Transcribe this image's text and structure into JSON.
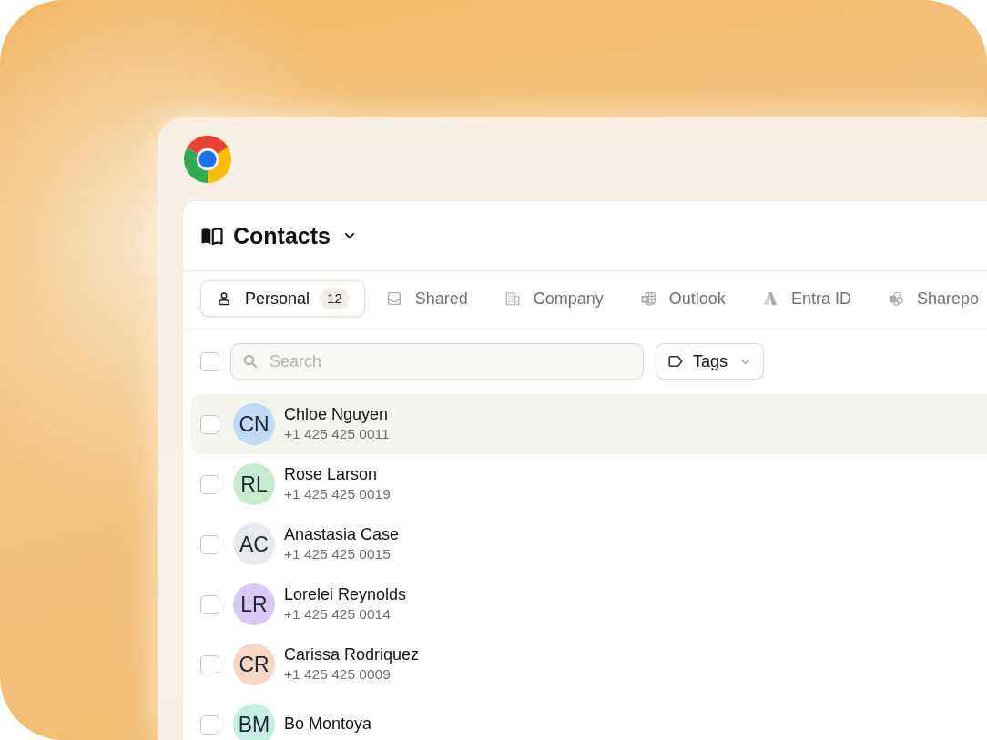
{
  "header": {
    "title": "Contacts"
  },
  "tabs": [
    {
      "kind": "personal",
      "label": "Personal",
      "count": "12",
      "selected": true
    },
    {
      "kind": "shared",
      "label": "Shared",
      "selected": false
    },
    {
      "kind": "company",
      "label": "Company",
      "selected": false
    },
    {
      "kind": "outlook",
      "label": "Outlook",
      "selected": false
    },
    {
      "kind": "entra",
      "label": "Entra ID",
      "selected": false
    },
    {
      "kind": "sharepoint",
      "label": "Sharepo",
      "selected": false
    }
  ],
  "toolbar": {
    "select_all": {
      "checked": false
    },
    "search": {
      "placeholder": "Search"
    },
    "tags_button": {
      "label": "Tags"
    }
  },
  "contacts": [
    {
      "initials": "CN",
      "name": "Chloe Nguyen",
      "phone": "+1 425 425 0011",
      "color": "#c1daf3",
      "selected": true,
      "checked": false
    },
    {
      "initials": "RL",
      "name": "Rose Larson",
      "phone": "+1 425 425 0019",
      "color": "#c9ebcd",
      "selected": false,
      "checked": false
    },
    {
      "initials": "AC",
      "name": "Anastasia Case",
      "phone": "+1 425 425 0015",
      "color": "#e8e9ee",
      "selected": false,
      "checked": false
    },
    {
      "initials": "LR",
      "name": "Lorelei Reynolds",
      "phone": "+1 425 425 0014",
      "color": "#dac9f6",
      "selected": false,
      "checked": false
    },
    {
      "initials": "CR",
      "name": "Carissa Rodriquez",
      "phone": "+1 425 425 0009",
      "color": "#f8d6c6",
      "selected": false,
      "checked": false
    },
    {
      "initials": "BM",
      "name": "Bo Montoya",
      "color": "#c3f0e3",
      "selected": false,
      "checked": false
    }
  ]
}
